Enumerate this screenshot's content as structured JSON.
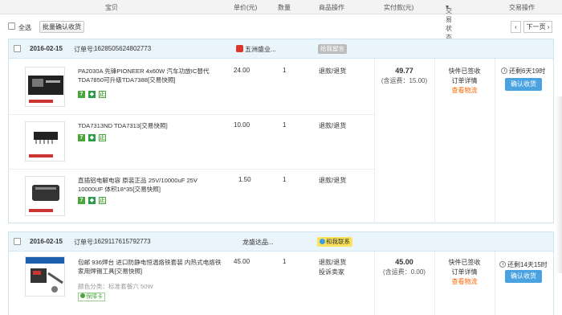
{
  "header": {
    "col_product": "宝贝",
    "col_price": "单价(元)",
    "col_qty": "数量",
    "col_ops": "商品操作",
    "col_paid": "实付款(元)",
    "col_status": "交易状态",
    "col_trade_ops": "交易操作"
  },
  "toolbar": {
    "select_all": "全选",
    "batch_confirm": "批量确认收货",
    "prev_arrow": "‹",
    "next_page": "下一页 ›"
  },
  "orders": [
    {
      "date": "2016-02-15",
      "order_no_label": "订单号:",
      "order_no": "1628505624802773",
      "shop": "五洲盛业...",
      "tag": "给我留言",
      "items": [
        {
          "name": "PA2030A 先锋PIONEER 4x60W 汽车功放IC替代TDA7850可升级TDA7388[交易快照]",
          "price": "24.00",
          "qty": "1",
          "op": "退款/退货"
        },
        {
          "name": "TDA7313ND TDA7313[交易快照]",
          "price": "10.00",
          "qty": "1",
          "op": "退款/退货"
        },
        {
          "name": "直插铝电解电容 原装正品 25V/10000uF 25V 10000UF 体积18*35[交易快照]",
          "price": "1.50",
          "qty": "1",
          "op": "退款/退货"
        }
      ],
      "paid": "49.77",
      "shipping": "(含运费：15.00)",
      "status_1": "快件已签收",
      "status_2": "订单详情",
      "status_3": "查看物流",
      "countdown": "还剩6天19时",
      "confirm": "确认收货"
    },
    {
      "date": "2016-02-15",
      "order_no_label": "订单号:",
      "order_no": "1629117615792773",
      "shop": "龙盛达品...",
      "tag": "和我联系",
      "items": [
        {
          "name": "包邮 936焊台 进口防静电恒温烙铁套装 内热式电烙铁家用焊锡工具[交易快照]",
          "price": "45.00",
          "qty": "1",
          "op": "退款/退货",
          "op2": "投诉卖家",
          "sku": "颜色分类：标准套餐六 50W",
          "guarantee": "保障卡"
        }
      ],
      "paid": "45.00",
      "shipping": "(含运费：0.00)",
      "status_1": "快件已签收",
      "status_2": "订单详情",
      "status_3": "查看物流",
      "countdown": "还剩14天15时",
      "confirm": "确认收货"
    }
  ],
  "badges": {
    "seven": "7",
    "check": "正"
  },
  "colors": {
    "accent": "#4aa3e0",
    "orange": "#ff6600",
    "header_bg": "#eaf4fb",
    "green": "#4aa63a"
  }
}
